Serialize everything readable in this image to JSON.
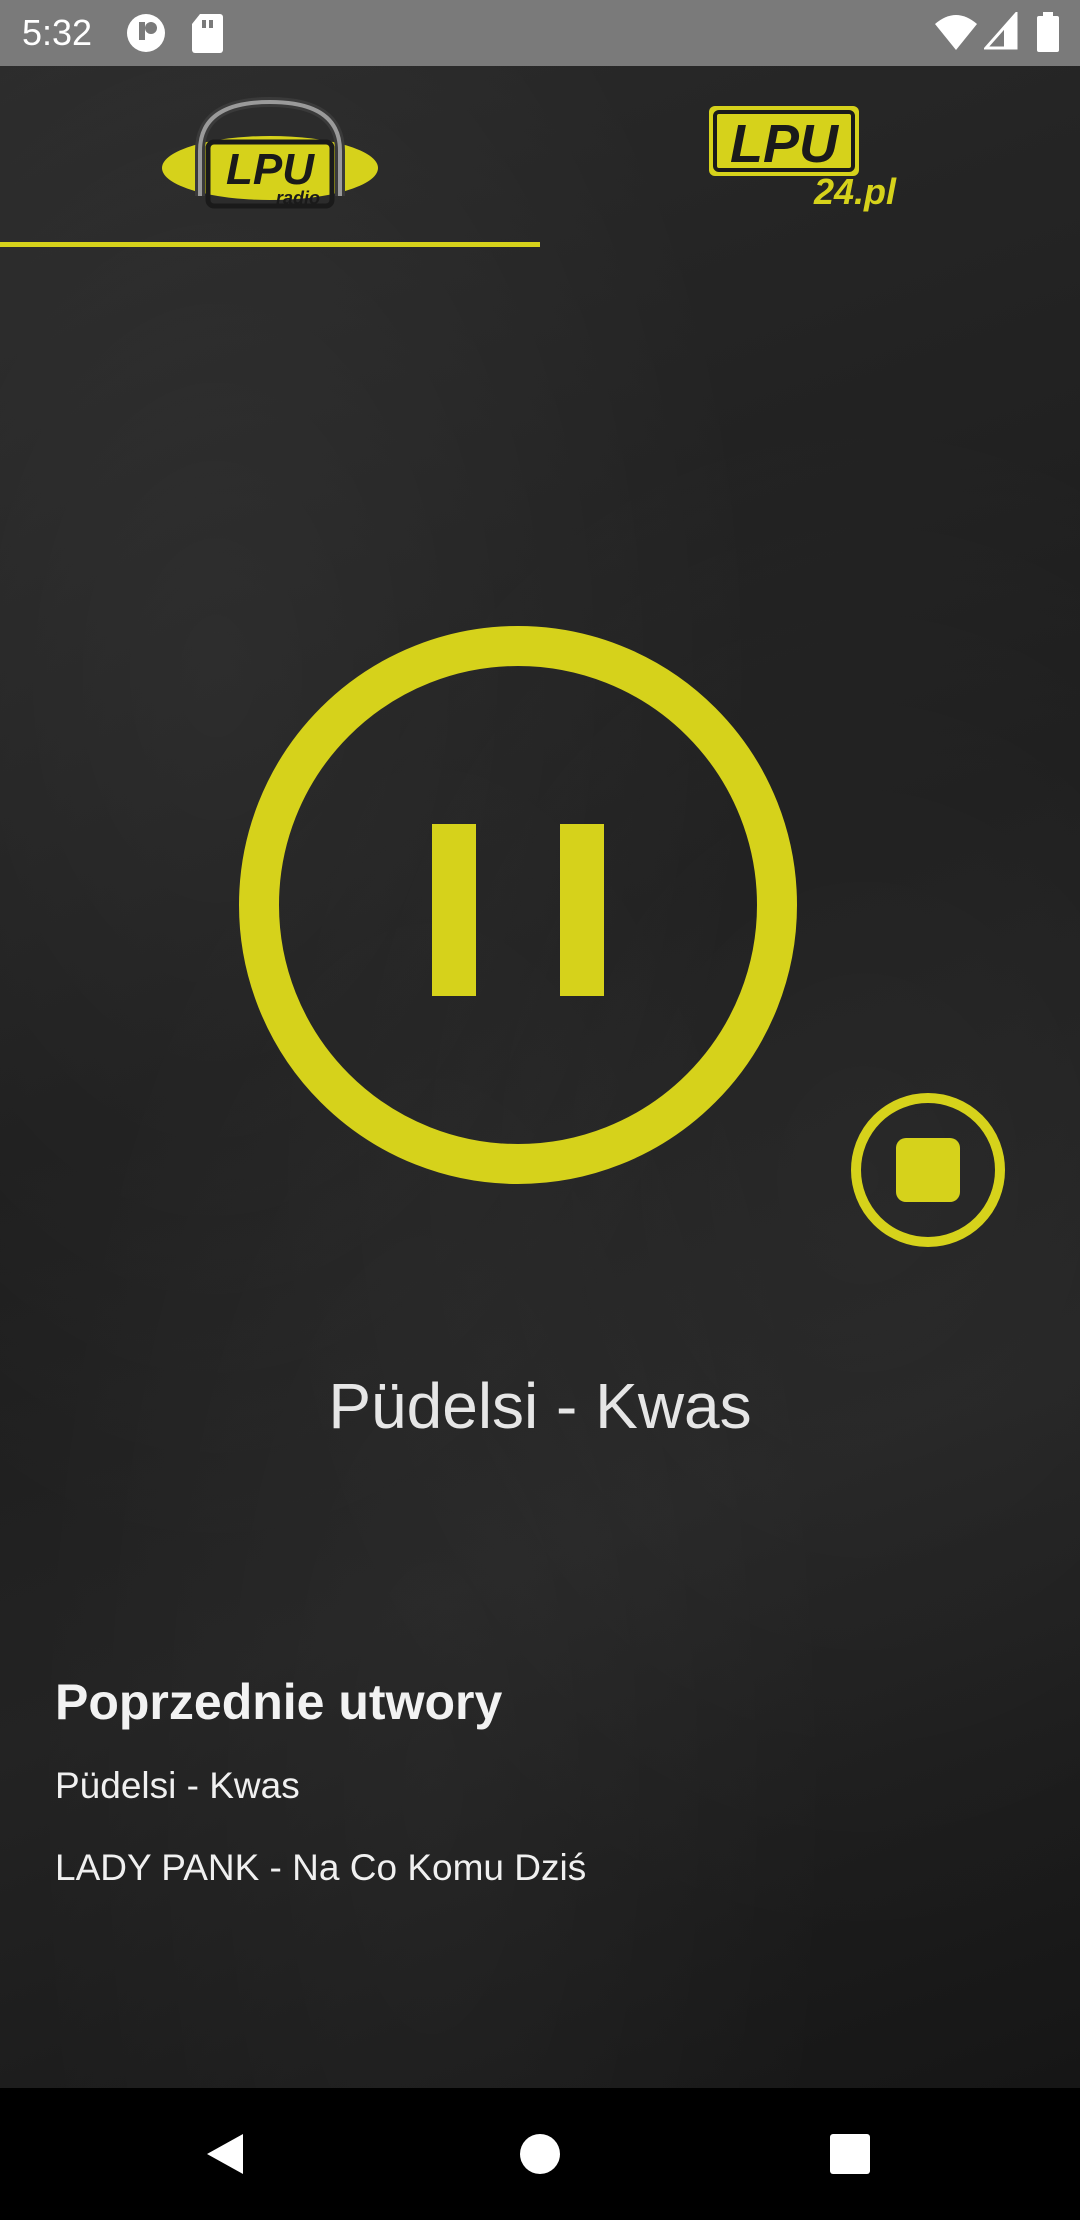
{
  "status_bar": {
    "time": "5:32",
    "icons": [
      "app-notification-icon",
      "sd-card-icon",
      "wifi-icon",
      "cellular-signal-icon",
      "battery-icon"
    ]
  },
  "tabs": [
    {
      "name": "lpu-radio",
      "logo_text": "LPU",
      "logo_subtext": "radio",
      "selected": true
    },
    {
      "name": "lpu24",
      "logo_text": "LPU",
      "logo_subtext": "24.pl",
      "selected": false
    }
  ],
  "player": {
    "state": "playing",
    "now_playing": "Püdelsi - Kwas"
  },
  "history": {
    "heading": "Poprzednie utwory",
    "items": [
      "Püdelsi - Kwas",
      "LADY PANK - Na Co Komu Dziś"
    ]
  },
  "colors": {
    "accent": "#d6d21b",
    "status_bar": "#7a7a7a",
    "text": "#e6e6e6"
  },
  "nav": {
    "buttons": [
      "back-icon",
      "home-icon",
      "recents-icon"
    ]
  }
}
